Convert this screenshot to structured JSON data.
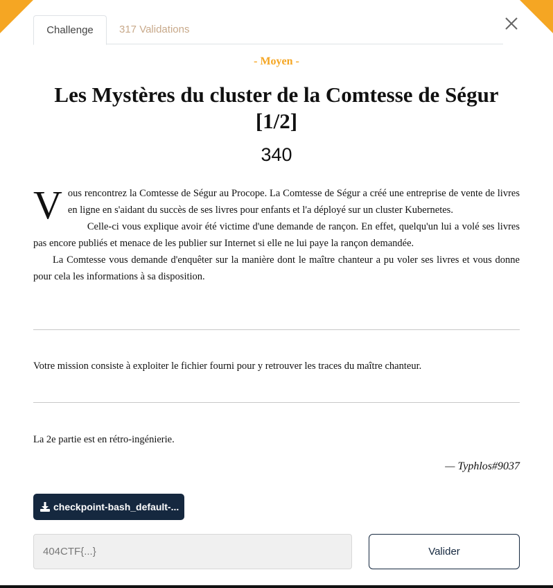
{
  "tabs": [
    {
      "label": "Challenge",
      "active": true
    },
    {
      "label": "317 Validations",
      "active": false
    }
  ],
  "challenge": {
    "difficulty": "- Moyen -",
    "title": "Les Mystères du cluster de la Comtesse de Ségur [1/2]",
    "points": "340",
    "description": {
      "dropcap": "V",
      "paragraphs": [
        "ous rencontrez la Comtesse de Ségur au Procope. La Comtesse de Ségur a créé une entreprise de vente de livres en ligne en s'aidant du succès de ses livres pour enfants et l'a déployé sur un cluster Kubernetes.",
        "Celle-ci vous explique avoir été victime d'une demande de rançon. En effet, quelqu'un lui a volé ses livres pas encore publiés et menace de les publier sur Internet si elle ne lui paye la rançon demandée.",
        "La Comtesse vous demande d'enquêter sur la manière dont le maître chanteur a pu voler ses livres et vous donne pour cela les informations à sa disposition."
      ]
    },
    "mission": "Votre mission consiste à exploiter le fichier fourni pour y retrouver les traces du maître chanteur.",
    "note": "La 2e partie est en rétro-ingénierie.",
    "author": "— Typhlos#9037"
  },
  "download": {
    "label": "checkpoint-bash_default-...",
    "icon": "download-icon"
  },
  "flag_form": {
    "placeholder": "404CTF{...}",
    "value": "",
    "submit_label": "Valider"
  },
  "colors": {
    "accent": "#f5a623",
    "dark": "#15283f",
    "tab_inactive": "#c8a98a"
  },
  "icons": {
    "close": "close-icon"
  }
}
